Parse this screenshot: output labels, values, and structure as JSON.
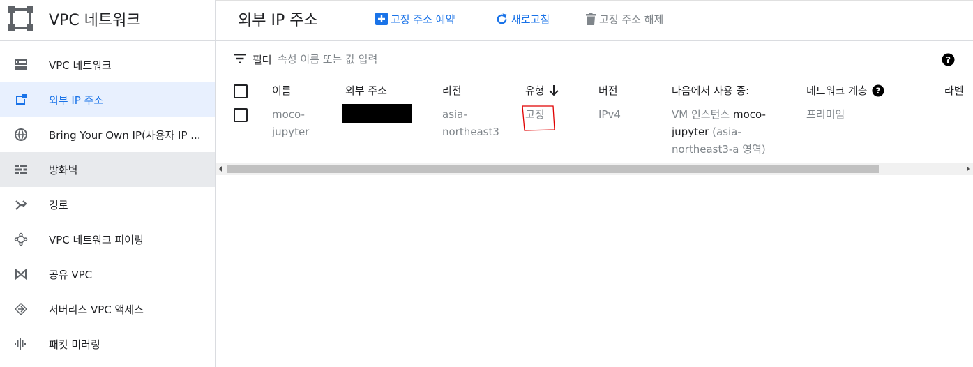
{
  "sidebar": {
    "title": "VPC 네트워크",
    "items": [
      {
        "label": "VPC 네트워크",
        "icon": "vpc-network-icon"
      },
      {
        "label": "외부 IP 주소",
        "icon": "external-ip-icon"
      },
      {
        "label": "Bring Your Own IP(사용자 IP ...",
        "icon": "globe-icon"
      },
      {
        "label": "방화벽",
        "icon": "firewall-icon"
      },
      {
        "label": "경로",
        "icon": "routes-icon"
      },
      {
        "label": "VPC 네트워크 피어링",
        "icon": "peering-icon"
      },
      {
        "label": "공유 VPC",
        "icon": "shared-vpc-icon"
      },
      {
        "label": "서버리스 VPC 액세스",
        "icon": "serverless-icon"
      },
      {
        "label": "패킷 미러링",
        "icon": "packet-mirroring-icon"
      }
    ]
  },
  "header": {
    "title": "외부 IP 주소",
    "reserve_label": "고정 주소 예약",
    "refresh_label": "새로고침",
    "release_label": "고정 주소 해제"
  },
  "filter": {
    "label": "필터",
    "placeholder": "속성 이름 또는 값 입력"
  },
  "table": {
    "columns": [
      "이름",
      "외부 주소",
      "리전",
      "유형",
      "버전",
      "다음에서 사용 중:",
      "네트워크 계층",
      "라벨"
    ],
    "rows": [
      {
        "name_line1": "moco-",
        "name_line2": "jupyter",
        "region_line1": "asia-",
        "region_line2": "northeast3",
        "type": "고정",
        "version": "IPv4",
        "used_by_prefix": "VM 인스턴스 ",
        "used_by_name1": "moco-",
        "used_by_name2": "jupyter",
        "used_by_zone1": " (asia-",
        "used_by_zone2": "northeast3-a 영역)",
        "tier": "프리미엄"
      }
    ]
  },
  "colors": {
    "accent": "#1a73e8",
    "active_bg": "#e8f0fe",
    "annotation": "#e00000"
  }
}
